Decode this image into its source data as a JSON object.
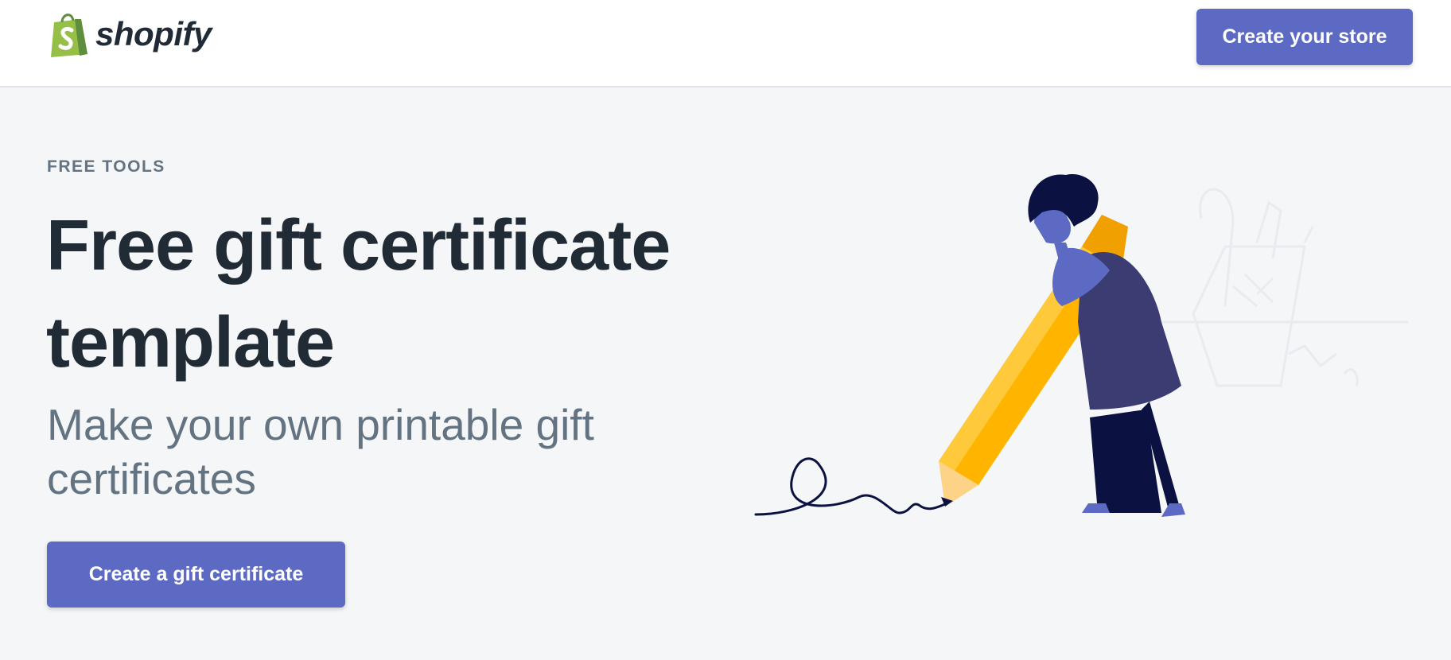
{
  "header": {
    "brand": "shopify",
    "cta_label": "Create your store"
  },
  "hero": {
    "eyebrow": "FREE TOOLS",
    "title": "Free gift certificate template",
    "subtitle": "Make your own printable gift certificates",
    "cta_label": "Create a gift certificate"
  },
  "colors": {
    "accent": "#5c6ac4",
    "brand_green": "#95bf47",
    "pencil_yellow": "#ffb400",
    "figure_navy": "#0b1241"
  },
  "icons": {
    "logo": "shopify-bag-icon"
  }
}
